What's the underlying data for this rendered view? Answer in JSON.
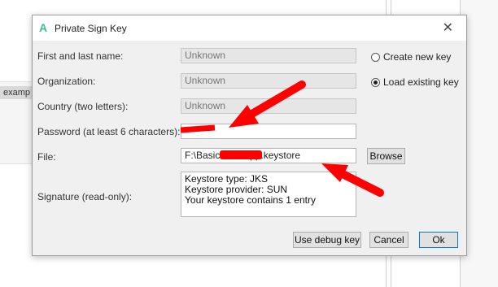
{
  "background": {
    "label": "examp"
  },
  "dialog": {
    "title": "Private Sign Key",
    "app_icon": "A",
    "close_glyph": "✕"
  },
  "form": {
    "name_label": "First and last name:",
    "name_value": "Unknown",
    "org_label": "Organization:",
    "org_value": "Unknown",
    "country_label": "Country (two letters):",
    "country_value": "Unknown",
    "password_label": "Password (at least 6 characters):",
    "password_value": "",
    "file_label": "File:",
    "file_value": "F:\\Basic\\          pp.keystore",
    "signature_label": "Signature (read-only):",
    "signature_lines": [
      "Keystore type: JKS",
      "Keystore provider: SUN",
      "Your keystore contains 1 entry"
    ]
  },
  "radios": {
    "create_label": "Create new key",
    "create_selected": false,
    "load_label": "Load existing key",
    "load_selected": true
  },
  "buttons": {
    "browse": "Browse",
    "debug": "Use debug key",
    "cancel": "Cancel",
    "ok": "Ok"
  },
  "colors": {
    "annotation": "#ff0000",
    "accent": "#0078d7",
    "app_icon": "#3dbb8e"
  }
}
